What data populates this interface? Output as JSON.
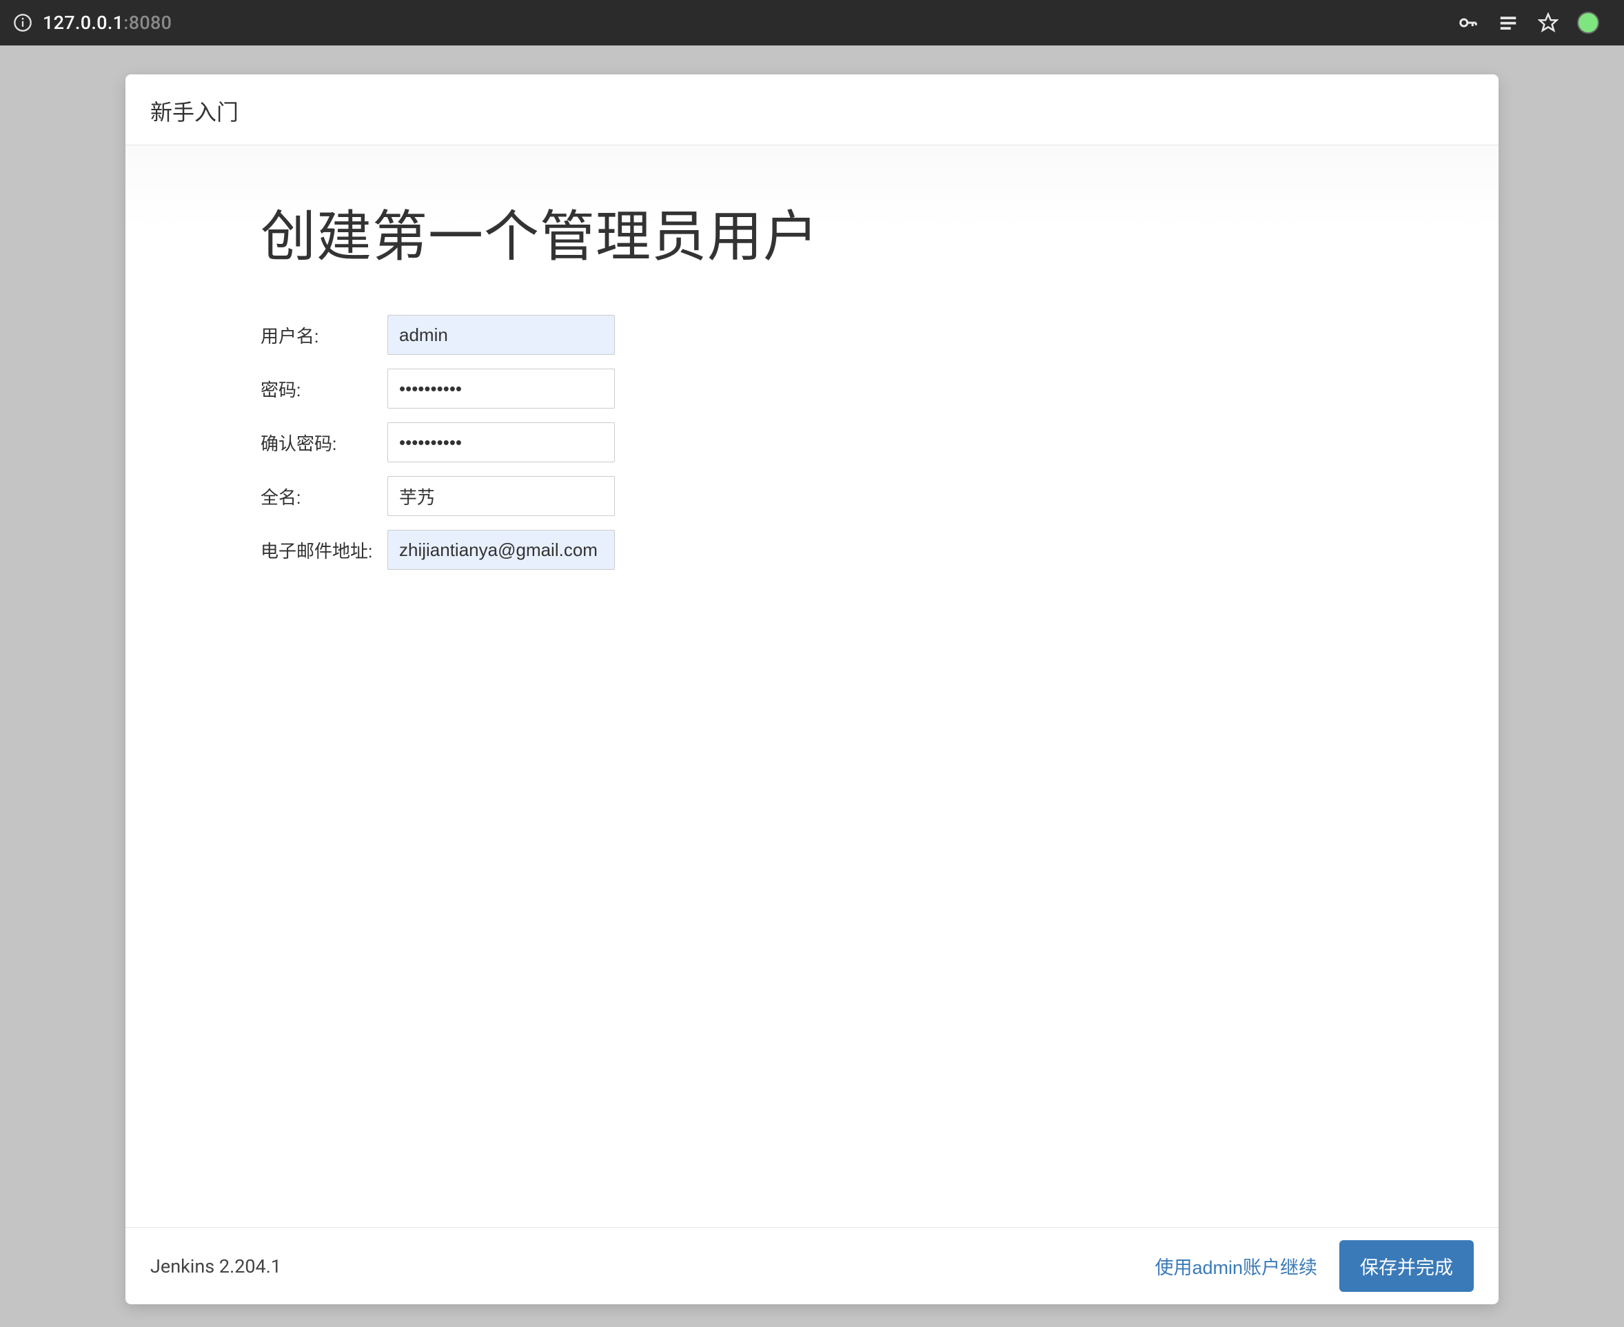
{
  "browser": {
    "url_host": "127.0.0.1",
    "url_port": ":8080"
  },
  "header": {
    "title": "新手入门"
  },
  "main": {
    "heading": "创建第一个管理员用户"
  },
  "form": {
    "username": {
      "label": "用户名:",
      "value": "admin"
    },
    "password": {
      "label": "密码:",
      "value": "••••••••••"
    },
    "confirm": {
      "label": "确认密码:",
      "value": "••••••••••"
    },
    "fullname": {
      "label": "全名:",
      "value": "芋艿"
    },
    "email": {
      "label": "电子邮件地址:",
      "value": "zhijiantianya@gmail.com"
    }
  },
  "footer": {
    "version": "Jenkins 2.204.1",
    "continue_as_admin": "使用admin账户继续",
    "save_and_finish": "保存并完成"
  }
}
